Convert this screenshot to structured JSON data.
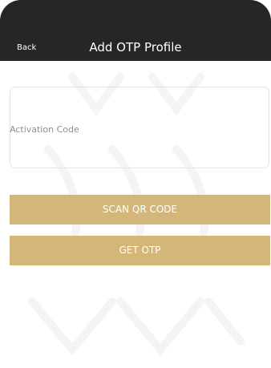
{
  "header": {
    "back_label": "Back",
    "title": "Add OTP Profile"
  },
  "form": {
    "activation_code_placeholder": "Activation Code",
    "activation_code_value": ""
  },
  "buttons": {
    "scan_label": "SCAN QR CODE",
    "get_otp_label": "GET OTP"
  },
  "colors": {
    "header_background": "#262626",
    "button_gold": "#d5b679",
    "page_background": "#ffffff"
  }
}
